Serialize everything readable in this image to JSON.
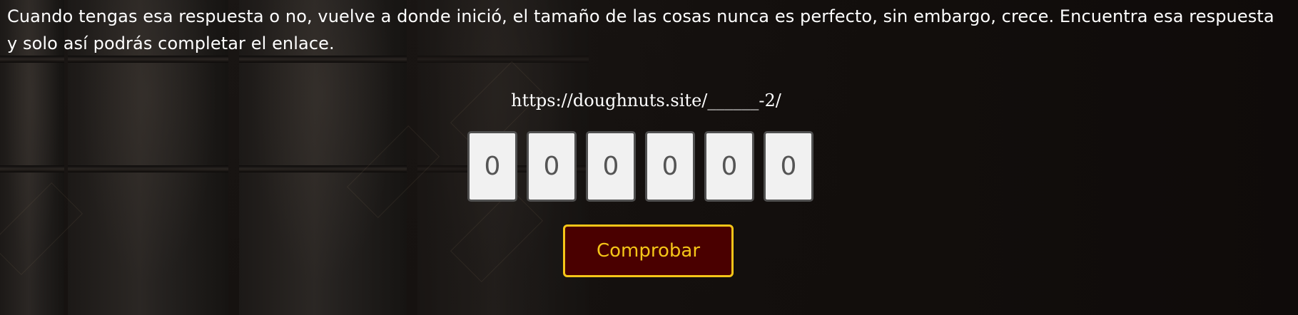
{
  "page": {
    "intro_text": "Cuando tengas esa respuesta o no, vuelve a donde inició, el tamaño de las cosas nunca es perfecto, sin embargo, crece. Encuentra esa respuesta y solo así podrás completar el enlace.",
    "url_text": "https://doughnuts.site/______-2/"
  },
  "code_inputs": [
    {
      "value": "0"
    },
    {
      "value": "0"
    },
    {
      "value": "0"
    },
    {
      "value": "0"
    },
    {
      "value": "0"
    },
    {
      "value": "0"
    }
  ],
  "actions": {
    "check_label": "Comprobar"
  },
  "colors": {
    "button_background": "#4a0000",
    "button_accent": "#f5c518",
    "input_background": "#f1f1f1",
    "text": "#ffffff"
  }
}
